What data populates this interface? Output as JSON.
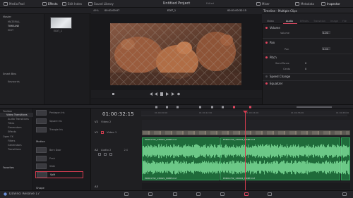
{
  "topbar": {
    "items": [
      {
        "label": "Media Pool",
        "icon": "media-pool-icon"
      },
      {
        "label": "Effects",
        "icon": "effects-icon"
      },
      {
        "label": "Edit Index",
        "icon": "edit-index-icon"
      },
      {
        "label": "Sound Library",
        "icon": "sound-library-icon"
      }
    ],
    "project_title": "Untitled Project",
    "edited_state": "Edited",
    "right_items": [
      {
        "label": "Mixer",
        "icon": "mixer-icon"
      },
      {
        "label": "Metadata",
        "icon": "metadata-icon"
      },
      {
        "label": "Inspector",
        "icon": "inspector-icon"
      }
    ]
  },
  "viewer": {
    "zoom": "49%",
    "source_timecode": "00:01:00:07",
    "clip_name": "EDIT_1",
    "timecode": "00:01:00:32:15"
  },
  "media_pool": {
    "header": "Master",
    "bins": [
      "MATERIAL",
      "TIMELINE",
      "EDIT"
    ],
    "smart_bins_header": "Smart Bins",
    "smart_bins": [
      "Keywords"
    ],
    "clips": [
      {
        "name": "EDIT_1"
      }
    ]
  },
  "inspector": {
    "title": "Timeline - Multiple Clips",
    "tabs": [
      "Video",
      "Audio",
      "Effects",
      "Transition",
      "Image",
      "File"
    ],
    "active_tab": "Audio",
    "sections": [
      {
        "name": "Volume",
        "params": [
          {
            "label": "Volume",
            "value": "0.00"
          }
        ]
      },
      {
        "name": "Pan",
        "params": [
          {
            "label": "Pan",
            "value": "0.00"
          }
        ]
      },
      {
        "name": "Pitch",
        "params": [
          {
            "label": "Semi-Tones",
            "value": "0"
          },
          {
            "label": "Cents",
            "value": "0"
          }
        ]
      },
      {
        "name": "Speed Change",
        "params": []
      },
      {
        "name": "Equalizer",
        "params": []
      }
    ]
  },
  "effects": {
    "tree": [
      {
        "label": "Toolbox",
        "level": 0
      },
      {
        "label": "Video Transitions",
        "level": 1,
        "selected": true
      },
      {
        "label": "Audio Transitions",
        "level": 1
      },
      {
        "label": "Titles",
        "level": 1
      },
      {
        "label": "Generators",
        "level": 1
      },
      {
        "label": "Effects",
        "level": 1
      },
      {
        "label": "Open FX",
        "level": 0
      },
      {
        "label": "Filters",
        "level": 1
      },
      {
        "label": "Generators",
        "level": 1
      },
      {
        "label": "Transitions",
        "level": 1
      },
      {
        "label": "Favorites",
        "level": 0
      }
    ],
    "list": [
      {
        "label": "Pentagon Iris"
      },
      {
        "label": "Square Iris"
      },
      {
        "label": "Triangle Iris"
      },
      {
        "label": "Motion",
        "is_header": true
      },
      {
        "label": "Barn Door"
      },
      {
        "label": "Push"
      },
      {
        "label": "Slide"
      },
      {
        "label": "Split",
        "highlighted": true
      },
      {
        "label": "Shape",
        "is_header": true
      }
    ]
  },
  "timeline": {
    "timecode": "01:00:32:15",
    "ruler_labels": [
      "01:00:00:00",
      "01:00:12:00",
      "01:00:24:00",
      "01:00:36:00",
      "01:00:48:00"
    ],
    "tracks": [
      {
        "id": "V2",
        "name": "Video 2"
      },
      {
        "id": "V1",
        "name": "Video 1"
      },
      {
        "id": "A2",
        "name": "Audio 2",
        "level": "2.0"
      },
      {
        "id": "A3",
        "name": ""
      }
    ],
    "audio_clips": [
      {
        "name": "PXD01732_130021_MXBT.mxf"
      },
      {
        "name": "PXD01732_130021_MXBT.mxf"
      },
      {
        "name": "PXD01732_130021_MXBT.mxf"
      },
      {
        "name": "PXD01732_130021_MXBT.mxf"
      }
    ],
    "colors": {
      "audio_clip": "#1f6b3a",
      "waveform": "#7fe09a",
      "playhead": "#d33c4f"
    }
  },
  "status": {
    "brand": "DaVinci Resolve 17",
    "pages": [
      "media-page-icon",
      "cut-page-icon",
      "edit-page-icon",
      "fusion-page-icon",
      "color-page-icon",
      "fairlight-page-icon",
      "deliver-page-icon"
    ],
    "active_page": "edit-page-icon"
  }
}
